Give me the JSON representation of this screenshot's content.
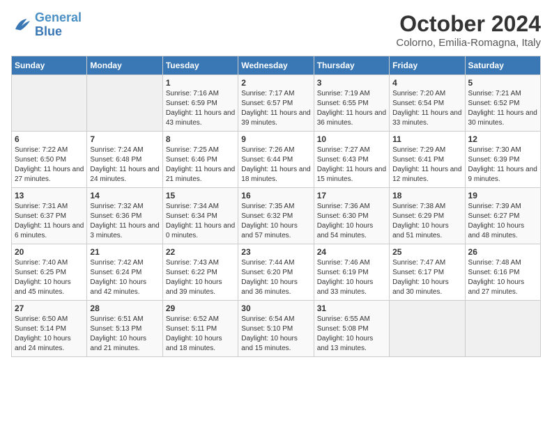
{
  "header": {
    "logo_line1": "General",
    "logo_line2": "Blue",
    "month": "October 2024",
    "location": "Colorno, Emilia-Romagna, Italy"
  },
  "weekdays": [
    "Sunday",
    "Monday",
    "Tuesday",
    "Wednesday",
    "Thursday",
    "Friday",
    "Saturday"
  ],
  "weeks": [
    [
      {
        "day": "",
        "info": ""
      },
      {
        "day": "",
        "info": ""
      },
      {
        "day": "1",
        "info": "Sunrise: 7:16 AM\nSunset: 6:59 PM\nDaylight: 11 hours and 43 minutes."
      },
      {
        "day": "2",
        "info": "Sunrise: 7:17 AM\nSunset: 6:57 PM\nDaylight: 11 hours and 39 minutes."
      },
      {
        "day": "3",
        "info": "Sunrise: 7:19 AM\nSunset: 6:55 PM\nDaylight: 11 hours and 36 minutes."
      },
      {
        "day": "4",
        "info": "Sunrise: 7:20 AM\nSunset: 6:54 PM\nDaylight: 11 hours and 33 minutes."
      },
      {
        "day": "5",
        "info": "Sunrise: 7:21 AM\nSunset: 6:52 PM\nDaylight: 11 hours and 30 minutes."
      }
    ],
    [
      {
        "day": "6",
        "info": "Sunrise: 7:22 AM\nSunset: 6:50 PM\nDaylight: 11 hours and 27 minutes."
      },
      {
        "day": "7",
        "info": "Sunrise: 7:24 AM\nSunset: 6:48 PM\nDaylight: 11 hours and 24 minutes."
      },
      {
        "day": "8",
        "info": "Sunrise: 7:25 AM\nSunset: 6:46 PM\nDaylight: 11 hours and 21 minutes."
      },
      {
        "day": "9",
        "info": "Sunrise: 7:26 AM\nSunset: 6:44 PM\nDaylight: 11 hours and 18 minutes."
      },
      {
        "day": "10",
        "info": "Sunrise: 7:27 AM\nSunset: 6:43 PM\nDaylight: 11 hours and 15 minutes."
      },
      {
        "day": "11",
        "info": "Sunrise: 7:29 AM\nSunset: 6:41 PM\nDaylight: 11 hours and 12 minutes."
      },
      {
        "day": "12",
        "info": "Sunrise: 7:30 AM\nSunset: 6:39 PM\nDaylight: 11 hours and 9 minutes."
      }
    ],
    [
      {
        "day": "13",
        "info": "Sunrise: 7:31 AM\nSunset: 6:37 PM\nDaylight: 11 hours and 6 minutes."
      },
      {
        "day": "14",
        "info": "Sunrise: 7:32 AM\nSunset: 6:36 PM\nDaylight: 11 hours and 3 minutes."
      },
      {
        "day": "15",
        "info": "Sunrise: 7:34 AM\nSunset: 6:34 PM\nDaylight: 11 hours and 0 minutes."
      },
      {
        "day": "16",
        "info": "Sunrise: 7:35 AM\nSunset: 6:32 PM\nDaylight: 10 hours and 57 minutes."
      },
      {
        "day": "17",
        "info": "Sunrise: 7:36 AM\nSunset: 6:30 PM\nDaylight: 10 hours and 54 minutes."
      },
      {
        "day": "18",
        "info": "Sunrise: 7:38 AM\nSunset: 6:29 PM\nDaylight: 10 hours and 51 minutes."
      },
      {
        "day": "19",
        "info": "Sunrise: 7:39 AM\nSunset: 6:27 PM\nDaylight: 10 hours and 48 minutes."
      }
    ],
    [
      {
        "day": "20",
        "info": "Sunrise: 7:40 AM\nSunset: 6:25 PM\nDaylight: 10 hours and 45 minutes."
      },
      {
        "day": "21",
        "info": "Sunrise: 7:42 AM\nSunset: 6:24 PM\nDaylight: 10 hours and 42 minutes."
      },
      {
        "day": "22",
        "info": "Sunrise: 7:43 AM\nSunset: 6:22 PM\nDaylight: 10 hours and 39 minutes."
      },
      {
        "day": "23",
        "info": "Sunrise: 7:44 AM\nSunset: 6:20 PM\nDaylight: 10 hours and 36 minutes."
      },
      {
        "day": "24",
        "info": "Sunrise: 7:46 AM\nSunset: 6:19 PM\nDaylight: 10 hours and 33 minutes."
      },
      {
        "day": "25",
        "info": "Sunrise: 7:47 AM\nSunset: 6:17 PM\nDaylight: 10 hours and 30 minutes."
      },
      {
        "day": "26",
        "info": "Sunrise: 7:48 AM\nSunset: 6:16 PM\nDaylight: 10 hours and 27 minutes."
      }
    ],
    [
      {
        "day": "27",
        "info": "Sunrise: 6:50 AM\nSunset: 5:14 PM\nDaylight: 10 hours and 24 minutes."
      },
      {
        "day": "28",
        "info": "Sunrise: 6:51 AM\nSunset: 5:13 PM\nDaylight: 10 hours and 21 minutes."
      },
      {
        "day": "29",
        "info": "Sunrise: 6:52 AM\nSunset: 5:11 PM\nDaylight: 10 hours and 18 minutes."
      },
      {
        "day": "30",
        "info": "Sunrise: 6:54 AM\nSunset: 5:10 PM\nDaylight: 10 hours and 15 minutes."
      },
      {
        "day": "31",
        "info": "Sunrise: 6:55 AM\nSunset: 5:08 PM\nDaylight: 10 hours and 13 minutes."
      },
      {
        "day": "",
        "info": ""
      },
      {
        "day": "",
        "info": ""
      }
    ]
  ]
}
